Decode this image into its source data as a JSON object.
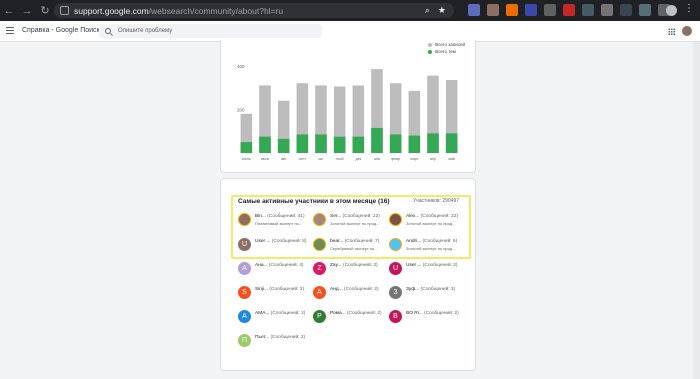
{
  "browser": {
    "url_host": "support.google.com",
    "url_path": "/websearch/community/about?hl=ru"
  },
  "app": {
    "title": "Справка - Google Поиск",
    "search_placeholder": "Опишите проблему"
  },
  "chart_data": {
    "type": "bar",
    "ylim": [
      0,
      500
    ],
    "yticks": [
      "400",
      "200"
    ],
    "categories": [
      "июнь",
      "июль",
      "авг",
      "сент",
      "окт",
      "нояб",
      "дек",
      "янв",
      "февр",
      "март",
      "апр",
      "май"
    ],
    "series": [
      {
        "name": "Всего записей",
        "color": "#bdbdbd",
        "values": [
          180,
          310,
          240,
          320,
          310,
          305,
          310,
          385,
          320,
          285,
          355,
          335
        ]
      },
      {
        "name": "Всего тем",
        "color": "#34a853",
        "values": [
          50,
          75,
          65,
          85,
          85,
          75,
          75,
          115,
          85,
          80,
          90,
          90
        ]
      }
    ]
  },
  "members": {
    "title": "Самые активные участники в этом месяце (16)",
    "count_label": "Участников: 290497",
    "top": [
      {
        "name": "Bin...",
        "count": "(Сообщений: 41)",
        "badge": "Платиновый эксперт по...",
        "color": "#8d6e63"
      },
      {
        "name": "Ser...",
        "count": "(Сообщений: 22)",
        "badge": "Золотой эксперт по прод...",
        "color": "#a1887f"
      },
      {
        "name": "Alex...",
        "count": "(Сообщений: 22)",
        "badge": "Золотой эксперт по прод...",
        "color": "#795548"
      },
      {
        "name": "User ...",
        "count": "(Сообщений: 8)",
        "badge": "",
        "color": "#8d6e63",
        "initial": "U"
      },
      {
        "name": "bear...",
        "count": "(Сообщений: 7)",
        "badge": "Серебряный эксперт по...",
        "color": "#6d8c5a"
      },
      {
        "name": "Andri...",
        "count": "(Сообщений: 6)",
        "badge": "Золотой эксперт по прод...",
        "color": "#4fc3f7"
      }
    ],
    "others": [
      {
        "initial": "A",
        "name": "Ана...",
        "count": "(Сообщений: 4)",
        "color": "#b39ddb"
      },
      {
        "initial": "Z",
        "name": "Zay...",
        "count": "(Сообщений: 3)",
        "color": "#d81b60"
      },
      {
        "initial": "U",
        "name": "User ...",
        "count": "(Сообщений: 3)",
        "color": "#c2185b"
      },
      {
        "initial": "S",
        "name": "Sinji...",
        "count": "(Сообщений: 3)",
        "color": "#f4511e"
      },
      {
        "initial": "A",
        "name": "Анд...",
        "count": "(Сообщений: 2)",
        "color": "#f4511e"
      },
      {
        "initial": "З",
        "name": "Зуф...",
        "count": "(Сообщений: 3)",
        "color": "#757575"
      },
      {
        "initial": "A",
        "name": "AMA...",
        "count": "(Сообщений: 2)",
        "color": "#1e88e5"
      },
      {
        "initial": "P",
        "name": "Рома...",
        "count": "(Сообщений: 2)",
        "color": "#2e7d32"
      },
      {
        "initial": "B",
        "name": "BO Ri...",
        "count": "(Сообщений: 2)",
        "color": "#c2185b"
      },
      {
        "initial": "П",
        "name": "Пьет...",
        "count": "(Сообщений: 2)",
        "color": "#9ccc65"
      }
    ]
  }
}
